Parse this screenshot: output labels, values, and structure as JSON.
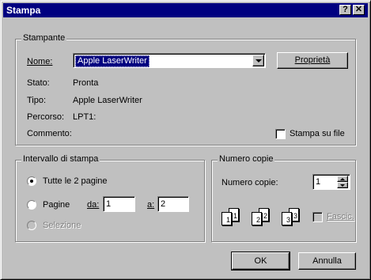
{
  "window": {
    "title": "Stampa",
    "help_label": "?",
    "close_label": "✕"
  },
  "printer": {
    "group_label": "Stampante",
    "name_label": "Nome:",
    "name_value": "Apple LaserWriter",
    "properties_label": "Proprietà",
    "status_label": "Stato:",
    "status_value": "Pronta",
    "type_label": "Tipo:",
    "type_value": "Apple LaserWriter",
    "path_label": "Percorso:",
    "path_value": "LPT1:",
    "comment_label": "Commento:",
    "print_to_file_label": "Stampa su file",
    "print_to_file_checked": false
  },
  "range": {
    "group_label": "Intervallo di stampa",
    "all_label": "Tutte le 2 pagine",
    "pages_label": "Pagine",
    "from_label": "da:",
    "from_value": "1",
    "to_label": "a:",
    "to_value": "2",
    "selection_label": "Selezione",
    "selected": "all"
  },
  "copies": {
    "group_label": "Numero copie",
    "count_label": "Numero copie:",
    "count_value": "1",
    "collate_label": "Fascic.",
    "collate_checked": false,
    "collate_enabled": false,
    "page_numbers": [
      "1",
      "1",
      "2",
      "2",
      "3",
      "3"
    ]
  },
  "actions": {
    "ok_label": "OK",
    "cancel_label": "Annulla"
  }
}
